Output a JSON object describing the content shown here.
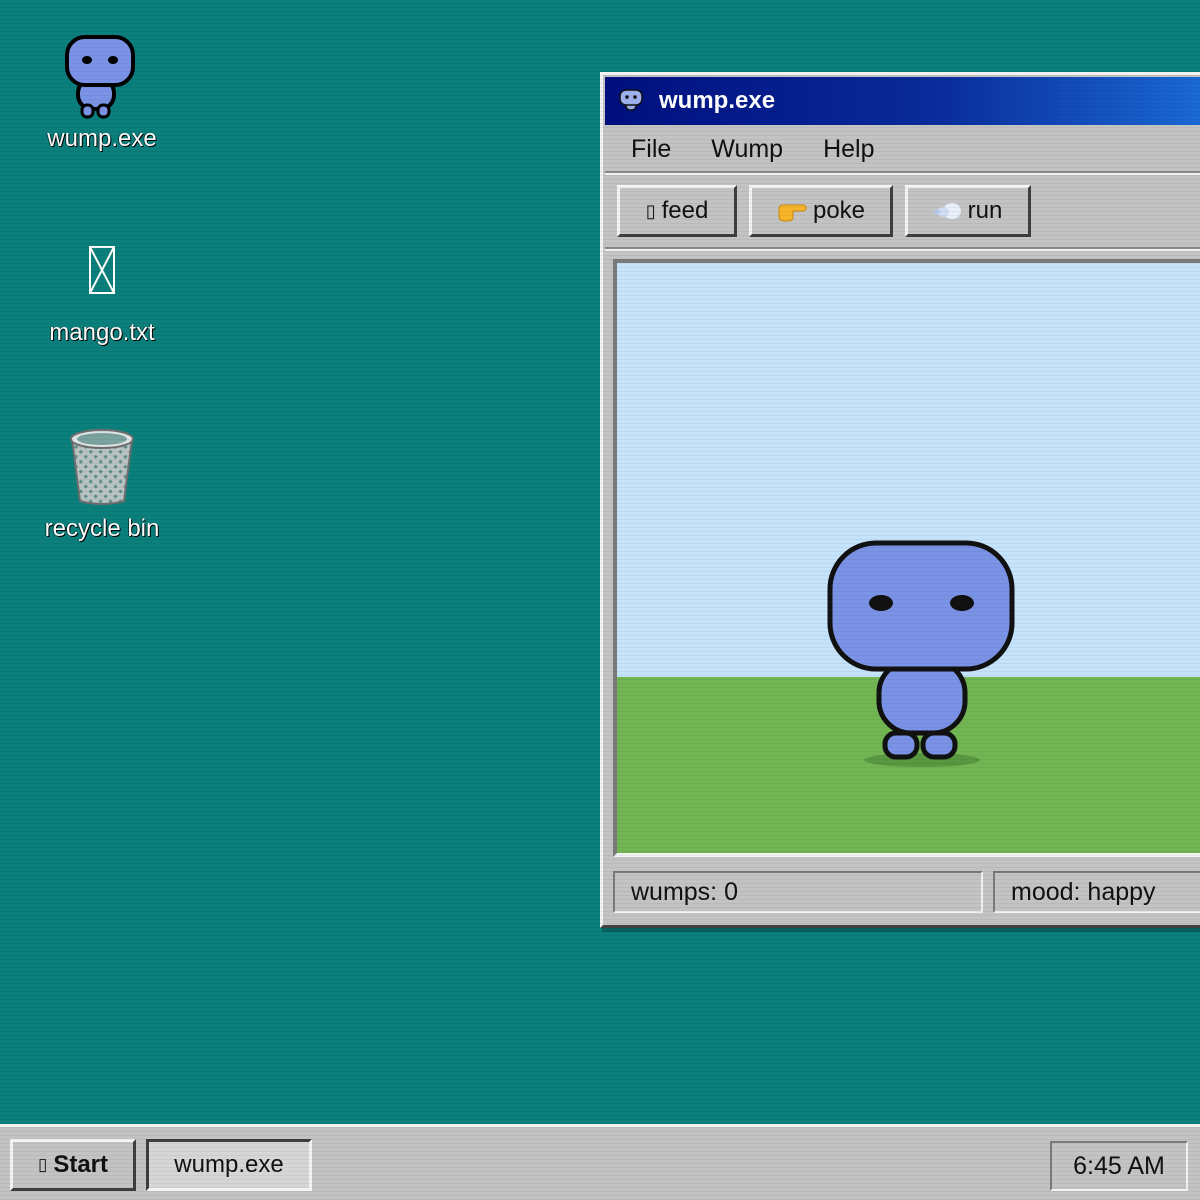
{
  "desktop": {
    "icons": [
      {
        "label": "wump.exe",
        "icon": "wump-icon"
      },
      {
        "label": "mango.txt",
        "icon": "missing-glyph-icon",
        "glyph": "⌧"
      },
      {
        "label": "recycle bin",
        "icon": "recycle-bin-icon"
      }
    ]
  },
  "window": {
    "title": "wump.exe",
    "menu": [
      "File",
      "Wump",
      "Help"
    ],
    "toolbar": [
      {
        "label": "feed",
        "icon": "missing-glyph-icon",
        "glyph": "▯"
      },
      {
        "label": "poke",
        "icon": "pointing-hand-icon"
      },
      {
        "label": "run",
        "icon": "dash-icon"
      }
    ],
    "status": {
      "wumps": "wumps: 0",
      "mood": "mood: happy"
    }
  },
  "taskbar": {
    "start_label": "Start",
    "start_glyph": "▯",
    "task_label": "wump.exe",
    "clock": "6:45 AM"
  },
  "colors": {
    "desktop": "#0b7f7b",
    "titlebar_start": "#000f80",
    "titlebar_end": "#1a6bd6",
    "wump_body": "#7b93e6",
    "sky": "#c5e4fb",
    "grass": "#72b653"
  }
}
